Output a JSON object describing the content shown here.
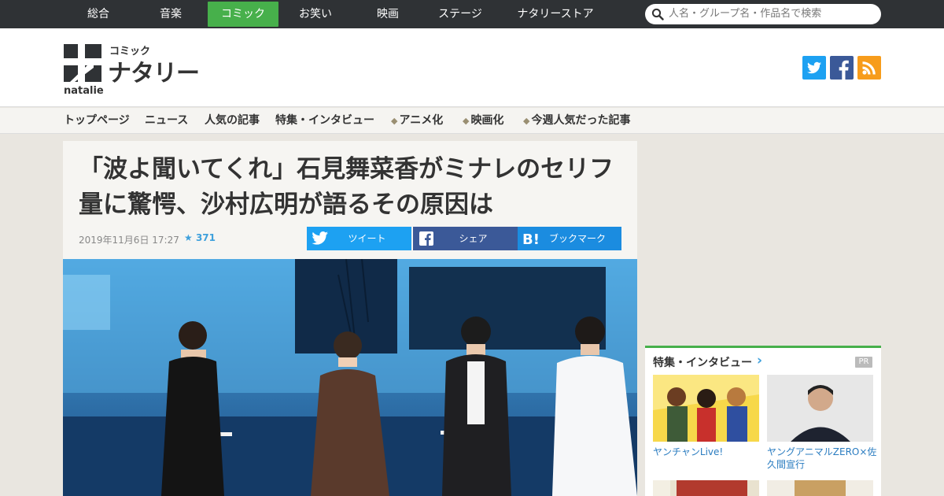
{
  "topnav": {
    "tabs": [
      {
        "label": "総合"
      },
      {
        "label": "音楽"
      },
      {
        "label": "コミック",
        "active": true
      },
      {
        "label": "お笑い"
      },
      {
        "label": "映画"
      },
      {
        "label": "ステージ"
      },
      {
        "label": "ナタリーストア"
      }
    ],
    "search_placeholder": "人名・グループ名・作品名で検索"
  },
  "logo": {
    "sub": "コミック",
    "main": "ナタリー",
    "en": "natalie"
  },
  "social": [
    {
      "icon": "twitter-icon",
      "color": "#1da1f2"
    },
    {
      "icon": "facebook-icon",
      "color": "#3b5998"
    },
    {
      "icon": "rss-icon",
      "color": "#f79c1b"
    }
  ],
  "subnav": [
    {
      "label": "トップページ"
    },
    {
      "label": "ニュース"
    },
    {
      "label": "人気の記事"
    },
    {
      "label": "特集・インタビュー"
    },
    {
      "label": "アニメ化",
      "tagged": true
    },
    {
      "label": "映画化",
      "tagged": true
    },
    {
      "label": "今週人気だった記事",
      "tagged": true
    }
  ],
  "article": {
    "title": "「波よ聞いてくれ」石見舞菜香がミナレのセリフ量に驚愕、沙村広明が語るその原因は",
    "date": "2019年11月6日 17:27",
    "stars": "371",
    "share": [
      {
        "label": "ツイート",
        "icon": "twitter-icon",
        "color": "#1da1f2"
      },
      {
        "label": "シェア",
        "icon": "facebook-icon",
        "color": "#3b5998"
      },
      {
        "label": "ブックマーク",
        "icon": "hatena-bookmark-icon",
        "color": "#1b8ce0"
      }
    ]
  },
  "sidebar": {
    "heading": "特集・インタビュー",
    "chevron": "›",
    "pr": "PR",
    "cards": [
      {
        "caption": "ヤンチャンLive!"
      },
      {
        "caption": "ヤングアニマルZERO×佐久間宣行"
      }
    ]
  },
  "colors": {
    "accent": "#47b04b",
    "link": "#2a7cc0",
    "topbar": "#2f3235"
  }
}
